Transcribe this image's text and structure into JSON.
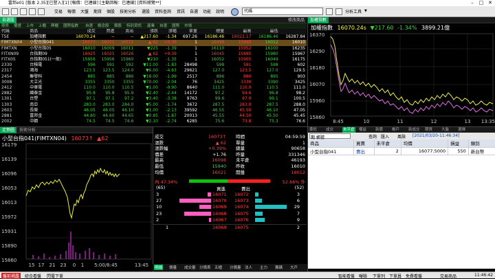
{
  "window": {
    "title": "富邦e01 [版本 2.35][已登入][1] [報價：已連線] [主動回報：已連線] [資料總覽**]"
  },
  "menu": [
    "交易",
    "報價",
    "大盤",
    "期貨",
    "個股",
    "技術分析",
    "選股",
    "資料查詢",
    "資訊",
    "自選",
    "功能",
    "說明"
  ],
  "search_placeholder": "代碼",
  "analysis_label": "分析工具",
  "watchlist": {
    "panel_label": "自選股",
    "right_label": "修改商品",
    "tabs": [
      "期貨",
      "權證",
      "上市",
      "上櫃",
      "興櫃",
      "國際指數",
      "自選",
      "概念股",
      "類股",
      "特別資訊",
      "產業",
      "自選",
      "國際",
      "市場"
    ],
    "columns": [
      "代碼",
      "商品",
      "成交",
      "買進",
      "賣出",
      "漲跌",
      "漲幅",
      "單量",
      "總量",
      "最高",
      "最低"
    ],
    "rows": [
      {
        "code": "TSE",
        "name": "加權指數",
        "last": "16070.24",
        "bid": "--",
        "ask": "--",
        "chg": "▲217.60",
        "pct": "-1.34",
        "vol": "697.26",
        "total": "16186.46",
        "high": "16022.17",
        "low": "16186.46",
        "extra": "16287.84",
        "c": "y",
        "sel": false
      },
      {
        "code": "FIMTXN04",
        "name": "小型台指041",
        "last": "16073",
        "bid": "16071",
        "ask": "16072",
        "chg": "▲ 62",
        "pct": "+0.39",
        "vol": "1",
        "total": "16098",
        "high": "15940",
        "low": "16012",
        "extra": "16010",
        "c": "r",
        "sel": true
      },
      {
        "code": "FIMTXN",
        "name": "小型台指05",
        "last": "16010",
        "bid": "16009",
        "ask": "16011",
        "chg": "▼225",
        "pct": "-1.39",
        "vol": "1",
        "total": "16110",
        "high": "15952",
        "low": "16100",
        "extra": "16235",
        "c": "g",
        "sel": false
      },
      {
        "code": "FITXN09",
        "name": "台指期09",
        "last": "16025",
        "bid": "16025",
        "ask": "16026",
        "chg": "▲ 62",
        "pct": "+0.39",
        "vol": "1",
        "total": "16045",
        "high": "15895",
        "low": "15980",
        "extra": "15967",
        "c": "r",
        "sel": false
      },
      {
        "code": "FITX05",
        "name": "台指期051(一般)",
        "last": "15956",
        "bid": "15956",
        "ask": "15960",
        "chg": "▼210",
        "pct": "-1.35",
        "vol": "1",
        "total": "16052",
        "high": "15905",
        "low": "16049",
        "extra": "16175",
        "c": "g",
        "sel": false
      },
      {
        "code": "2330",
        "name": "台積電",
        "last": "596",
        "bid": "591",
        "ask": "592",
        "chg": "▼11.00",
        "pct": "-1.83",
        "vol": "28498",
        "total": "598",
        "high": "591",
        "low": "598",
        "extra": "602",
        "c": "g",
        "sel": false
      },
      {
        "code": "2317",
        "name": "鴻海",
        "last": "123.5",
        "bid": "123.5",
        "ask": "124.0",
        "chg": "▼6.00",
        "pct": "-4.63",
        "vol": "29621",
        "total": "127.0",
        "high": "123.5",
        "low": "127.0",
        "extra": "129.5",
        "c": "g",
        "sel": false
      },
      {
        "code": "2454",
        "name": "聯發科",
        "last": "885",
        "bid": "885",
        "ask": "886",
        "chg": "▼18.00",
        "pct": "-1.99",
        "vol": "2517",
        "total": "896",
        "high": "880",
        "low": "895",
        "extra": "903",
        "c": "g",
        "sel": false
      },
      {
        "code": "3008",
        "name": "大立光",
        "last": "3355",
        "bid": "3350",
        "ask": "3355",
        "chg": "▼70.00",
        "pct": "-2.04",
        "vol": "76",
        "total": "3425",
        "high": "3330",
        "low": "3390",
        "extra": "3425",
        "c": "g",
        "sel": false
      },
      {
        "code": "2412",
        "name": "中華電",
        "last": "110.0",
        "bid": "110.0",
        "ask": "110.5",
        "chg": "▼1.00",
        "pct": "-0.90",
        "vol": "8640",
        "total": "111.0",
        "high": "110.0",
        "low": "110.5",
        "extra": "111.0",
        "c": "g",
        "sel": false
      },
      {
        "code": "2882",
        "name": "國泰金",
        "last": "95.8",
        "bid": "95.8",
        "ask": "95.9",
        "chg": "▼2.40",
        "pct": "-2.44",
        "vol": "14172",
        "total": "97.2",
        "high": "94.6",
        "low": "96.8",
        "extra": "98.2",
        "c": "g",
        "sel": false
      },
      {
        "code": "1301",
        "name": "台塑",
        "last": "97.1",
        "bid": "97.1",
        "ask": "97.2",
        "chg": "▼3.40",
        "pct": "-3.38",
        "vol": "9763",
        "total": "99.6",
        "high": "97.0",
        "low": "99.1",
        "extra": "100.5",
        "c": "g",
        "sel": false
      },
      {
        "code": "1303",
        "name": "南亞",
        "last": "283.0",
        "bid": "283.0",
        "ask": "284.0",
        "chg": "▼5.00",
        "pct": "-1.74",
        "vol": "3672",
        "total": "287.5",
        "high": "283.0",
        "low": "287.5",
        "extra": "288.0",
        "c": "g",
        "sel": false
      },
      {
        "code": "2603",
        "name": "長榮",
        "last": "46.05",
        "bid": "46.05",
        "ask": "46.10",
        "chg": "▼1.00",
        "pct": "-2.13",
        "vol": "39592",
        "total": "46.55",
        "high": "45.50",
        "low": "46.10",
        "extra": "47.05",
        "c": "g",
        "sel": false
      },
      {
        "code": "2881",
        "name": "富邦金",
        "last": "44.60",
        "bid": "44.60",
        "ask": "44.65",
        "chg": "▼0.85",
        "pct": "-1.87",
        "vol": "20013",
        "total": "45.55",
        "high": "44.50",
        "low": "45.50",
        "extra": "45.45",
        "c": "g",
        "sel": false
      },
      {
        "code": "2002",
        "name": "中鋼",
        "last": "74.5",
        "bid": "74.5",
        "ask": "74.6",
        "chg": "▼2.10",
        "pct": "-2.74",
        "vol": "6285",
        "total": "75.6",
        "high": "73.8",
        "low": "75.3",
        "extra": "76.6",
        "c": "g",
        "sel": false
      }
    ]
  },
  "index_chart": {
    "tab": "加權指數",
    "name": "加權指數",
    "last": "16070.24s",
    "chg": "▼217.60",
    "pct": "-1.34%",
    "amount": "3899.21億",
    "yticks": [
      "16370",
      "16290",
      "16180",
      "16070",
      "15960",
      "15860"
    ],
    "xticks": [
      "8:45",
      "10",
      "11",
      "12",
      "13",
      "13:35"
    ]
  },
  "mini_chart": {
    "tabs": [
      "走勢圖",
      "技術分析"
    ],
    "title": "小型台指041(FIMTXN04)",
    "last": "16073↑",
    "chg": "▲62",
    "yticks": [
      "16179",
      "16139",
      "16096",
      "16053",
      "16013",
      "15972",
      "15931",
      "15890",
      "15860"
    ],
    "xticks": [
      "15",
      "17",
      "21",
      "23",
      "0",
      "1",
      "5:00/8:45",
      "13:45"
    ]
  },
  "quote": {
    "rows": [
      {
        "l": "成交",
        "v": "16073↑",
        "vc": "r",
        "l2": "時間",
        "v2": "04:59:59",
        "v2c": "w"
      },
      {
        "l": "漲跌",
        "v": "▲ 62",
        "vc": "r",
        "l2": "單量",
        "v2": "1",
        "v2c": "w"
      },
      {
        "l": "漲跌幅",
        "v": "+0.39%",
        "vc": "r",
        "l2": "總量",
        "v2": "90658",
        "v2c": "w"
      },
      {
        "l": "價差",
        "v": "+1.76",
        "vc": "w",
        "l2": "昨量",
        "v2": "331346",
        "v2c": "w"
      },
      {
        "l": "最高",
        "v": "16098",
        "vc": "r",
        "l2": "未平倉",
        "v2": "46193",
        "v2c": "w"
      },
      {
        "l": "最低",
        "v": "15940",
        "vc": "g",
        "l2": "昨收",
        "v2": "16010",
        "v2c": "w"
      },
      {
        "l": "均價",
        "v": "16021",
        "vc": "r",
        "l2": "開盤",
        "v2": "16012",
        "v2c": "r"
      }
    ],
    "ratio_left": "內 47.34%",
    "ratio_right": "52.66% 外",
    "ratio_value": 0.4734,
    "count_left": "(65)",
    "count_right": "(52)",
    "bid_head": "買進",
    "ask_head": "賣出",
    "book": [
      {
        "bq": "3",
        "bp": "16071",
        "ap": "16072",
        "aq": "3",
        "bf": 0.11,
        "af": 0.11
      },
      {
        "bq": "27",
        "bp": "16070",
        "ap": "16073",
        "aq": "6",
        "bf": 1.0,
        "af": 0.22
      },
      {
        "bq": "10",
        "bp": "16069",
        "ap": "16074",
        "aq": "29",
        "bf": 0.37,
        "af": 1.0
      },
      {
        "bq": "23",
        "bp": "16068",
        "ap": "16075",
        "aq": "7",
        "bf": 0.85,
        "af": 0.24
      },
      {
        "bq": "2",
        "bp": "16067",
        "ap": "16076",
        "aq": "9",
        "bf": 0.07,
        "af": 0.31
      }
    ],
    "total_left": "1",
    "total_bid": "16069",
    "total_ask": "16075",
    "total_right": "2",
    "bottom_tabs": [
      "明細",
      "價量",
      "成交量",
      "分價表",
      "五檔",
      "分價量",
      "法人",
      "主力",
      "籌碼",
      "大戶"
    ]
  },
  "orders": {
    "tabs": [
      "委託",
      "成交",
      "未平倉",
      "權益",
      "新委",
      "帳戶",
      "新成交",
      "期貨",
      "大盤",
      "選擇"
    ],
    "account_label": "期 帳號",
    "query": "查詢",
    "export": "匯入",
    "settings": "風險",
    "date": "[2021/03/20-11:46:34]",
    "columns": [
      "商品",
      "買賣",
      "未平倉",
      "均價",
      "損益",
      "類別"
    ],
    "rows": [
      {
        "product": "小型台指041",
        "side": "賣出",
        "qty": "2",
        "avg": "16077.5000",
        "pl": "550",
        "type": "新台幣"
      }
    ]
  },
  "statusbar": {
    "items": [
      "盤前揭露",
      "綜合看盤",
      "閃電下單"
    ],
    "right": [
      "智能看盤",
      "曝險",
      "下單列",
      "下單員",
      "免費看盤",
      "交易商品"
    ],
    "time": "11:46:42"
  }
}
